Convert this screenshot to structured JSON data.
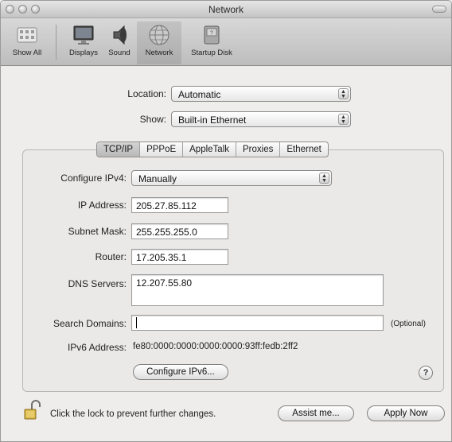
{
  "window": {
    "title": "Network"
  },
  "toolbar": {
    "items": [
      {
        "label": "Show All",
        "icon": "show-all-icon"
      },
      {
        "label": "Displays",
        "icon": "displays-icon"
      },
      {
        "label": "Sound",
        "icon": "sound-icon"
      },
      {
        "label": "Network",
        "icon": "network-icon"
      },
      {
        "label": "Startup Disk",
        "icon": "startup-disk-icon"
      }
    ],
    "selected": "Network"
  },
  "location": {
    "label": "Location:",
    "value": "Automatic"
  },
  "show": {
    "label": "Show:",
    "value": "Built-in Ethernet"
  },
  "tabs": [
    {
      "label": "TCP/IP",
      "active": true
    },
    {
      "label": "PPPoE"
    },
    {
      "label": "AppleTalk"
    },
    {
      "label": "Proxies"
    },
    {
      "label": "Ethernet"
    }
  ],
  "tcpip": {
    "configure_label": "Configure IPv4:",
    "configure_value": "Manually",
    "ip_label": "IP Address:",
    "ip_value": "205.27.85.112",
    "subnet_label": "Subnet Mask:",
    "subnet_value": "255.255.255.0",
    "router_label": "Router:",
    "router_value": "17.205.35.1",
    "dns_label": "DNS Servers:",
    "dns_value": "12.207.55.80",
    "search_label": "Search Domains:",
    "search_value": "",
    "search_hint": "(Optional)",
    "ipv6_label": "IPv6 Address:",
    "ipv6_value": "fe80:0000:0000:0000:0000:93ff:fedb:2ff2",
    "configure_ipv6_button": "Configure IPv6...",
    "help_glyph": "?"
  },
  "footer": {
    "lock_text": "Click the lock to prevent further changes.",
    "assist_button": "Assist me...",
    "apply_button": "Apply Now"
  }
}
